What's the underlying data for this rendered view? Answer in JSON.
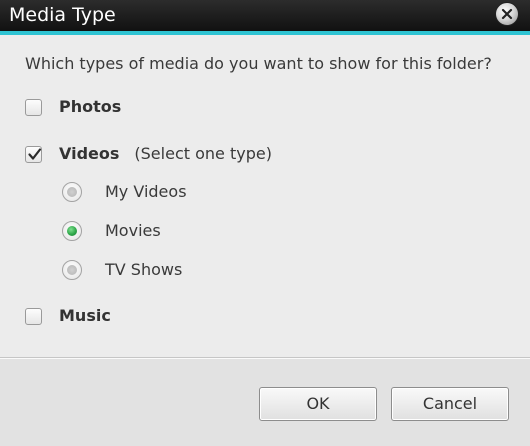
{
  "window": {
    "title": "Media Type",
    "close_icon": "close-icon"
  },
  "colors": {
    "titlebar": "#1a1a1a",
    "accent": "#2ec3d2",
    "radio_selected": "#2fa84a",
    "background": "#ececec"
  },
  "question": "Which types of media do you want to show for this folder?",
  "options": {
    "photos": {
      "label": "Photos",
      "checked": false
    },
    "videos": {
      "label": "Videos",
      "hint": "(Select one type)",
      "checked": true,
      "types": [
        {
          "label": "My Videos",
          "selected": false
        },
        {
          "label": "Movies",
          "selected": true
        },
        {
          "label": "TV Shows",
          "selected": false
        }
      ]
    },
    "music": {
      "label": "Music",
      "checked": false
    }
  },
  "buttons": {
    "ok_label": "OK",
    "cancel_label": "Cancel"
  }
}
